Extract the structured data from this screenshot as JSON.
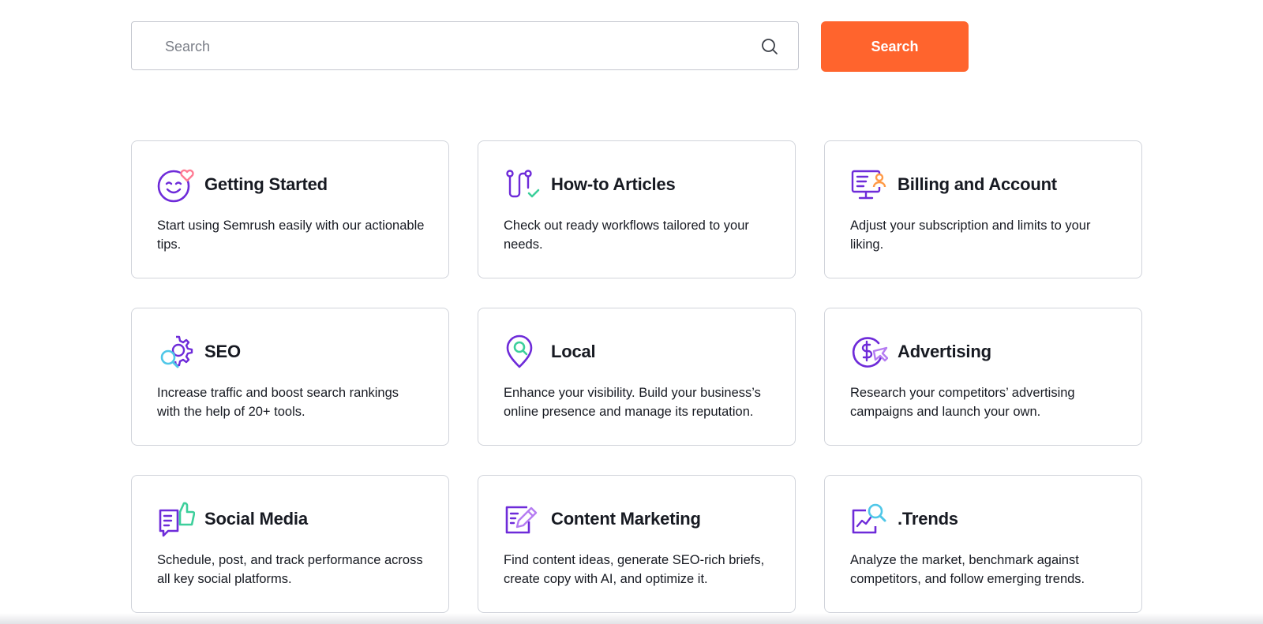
{
  "search": {
    "placeholder": "Search",
    "value": "",
    "button_label": "Search",
    "accent_color": "#ff642d"
  },
  "colors": {
    "purple": "#6e2bd9",
    "pink": "#ff7b93",
    "green": "#3ccf9b",
    "orange": "#ff9a47",
    "cyan": "#4fc7e8"
  },
  "cards": [
    {
      "title": "Getting Started",
      "description": "Start using Semrush easily with our actionable tips.",
      "icon": "smiley-heart-icon"
    },
    {
      "title": "How-to Articles",
      "description": "Check out ready workflows tailored to your needs.",
      "icon": "workflow-icon"
    },
    {
      "title": "Billing and Account",
      "description": "Adjust your subscription and limits to your liking.",
      "icon": "billing-monitor-icon"
    },
    {
      "title": "SEO",
      "description": "Increase traffic and boost search rankings with the help of 20+ tools.",
      "icon": "seo-gear-icon"
    },
    {
      "title": "Local",
      "description": "Enhance your visibility. Build your business’s online presence and manage its reputation.",
      "icon": "local-pin-icon"
    },
    {
      "title": "Advertising",
      "description": "Research your competitors’ advertising campaigns and launch your own.",
      "icon": "advertising-dollar-icon"
    },
    {
      "title": "Social Media",
      "description": "Schedule, post, and track performance across all key social platforms.",
      "icon": "thumbs-up-icon"
    },
    {
      "title": "Content Marketing",
      "description": "Find content ideas, generate SEO-rich briefs, create copy with AI, and optimize it.",
      "icon": "content-edit-icon"
    },
    {
      "title": ".Trends",
      "description": "Analyze the market, benchmark against competitors, and follow emerging trends.",
      "icon": "trends-icon"
    }
  ]
}
